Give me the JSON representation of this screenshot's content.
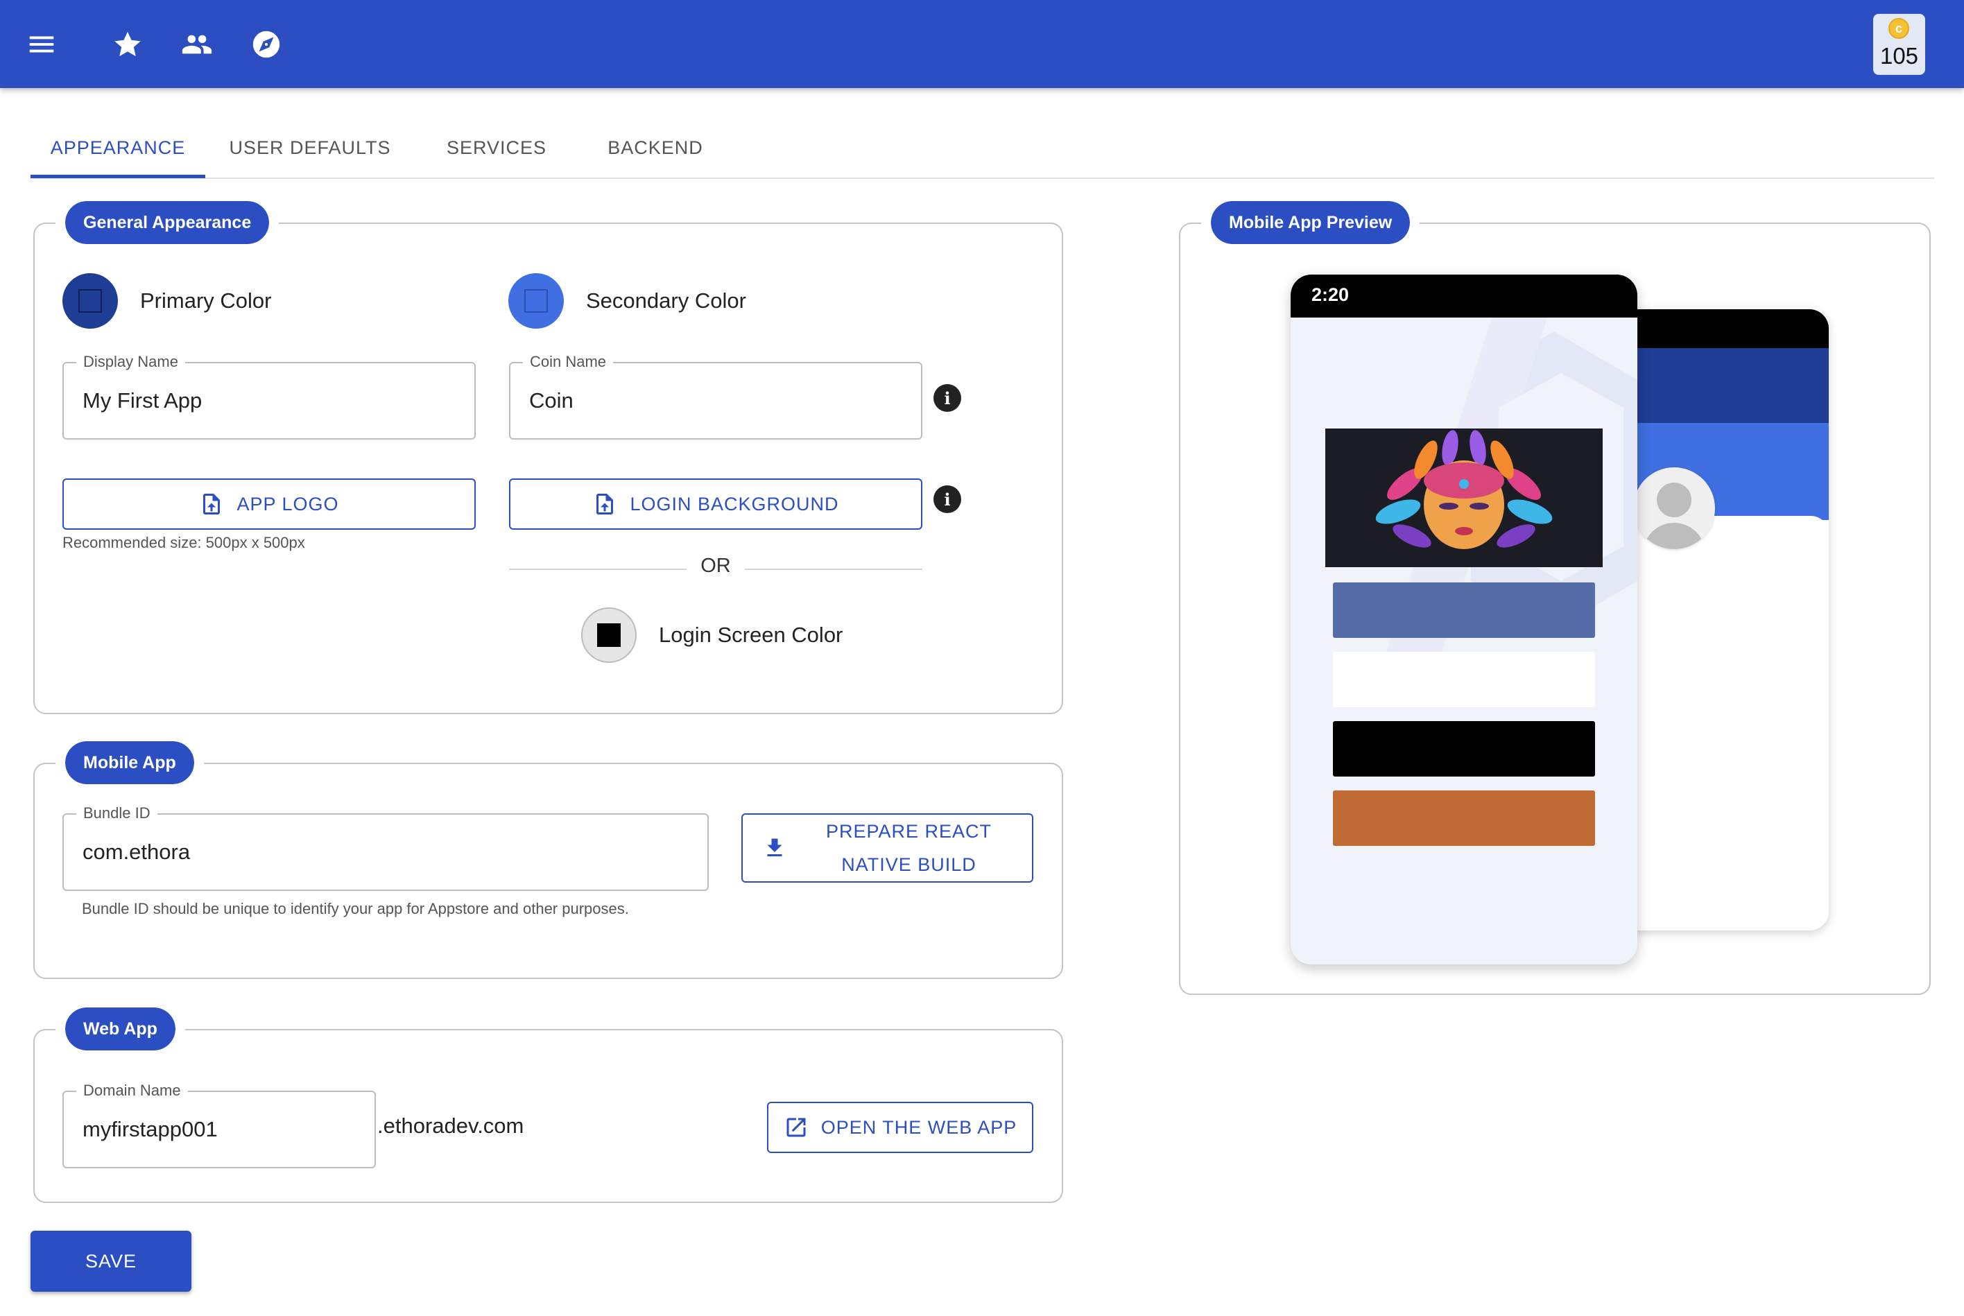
{
  "appbar": {
    "coin_badge_value": "105",
    "colors": {
      "background": "#2b4fc2",
      "coin": "#f4c234"
    }
  },
  "tabs": [
    {
      "label": "APPEARANCE",
      "active": true
    },
    {
      "label": "USER DEFAULTS",
      "active": false
    },
    {
      "label": "SERVICES",
      "active": false
    },
    {
      "label": "BACKEND",
      "active": false
    }
  ],
  "general": {
    "section_title": "General Appearance",
    "primary_color_label": "Primary Color",
    "primary_color": "#1e3d95",
    "secondary_color_label": "Secondary Color",
    "secondary_color": "#3f6fe0",
    "display_name_label": "Display Name",
    "display_name_value": "My First App",
    "coin_name_label": "Coin Name",
    "coin_name_value": "Coin",
    "app_logo_button": "APP LOGO",
    "logo_helper": "Recommended size: 500px x 500px",
    "login_background_button": "LOGIN BACKGROUND",
    "or_label": "OR",
    "login_screen_color_label": "Login Screen Color",
    "login_screen_color": "#000000"
  },
  "mobile": {
    "section_title": "Mobile App",
    "bundle_id_label": "Bundle ID",
    "bundle_id_value": "com.ethora",
    "bundle_helper": "Bundle ID should be unique to identify your app for Appstore and other purposes.",
    "prepare_button_line1": "PREPARE REACT",
    "prepare_button_line2": "NATIVE BUILD"
  },
  "web": {
    "section_title": "Web App",
    "domain_label": "Domain Name",
    "domain_value": "myfirstapp001",
    "domain_suffix": ".ethoradev.com",
    "open_button": "OPEN THE WEB APP"
  },
  "save_button": "SAVE",
  "preview": {
    "section_title": "Mobile App Preview",
    "status_time": "2:20",
    "bar_colors": [
      "#556ca7",
      "#ffffff",
      "#000000",
      "#c06a35"
    ],
    "back_header_colors": [
      "#000000",
      "#1e3d95",
      "#3f6fe0"
    ]
  }
}
